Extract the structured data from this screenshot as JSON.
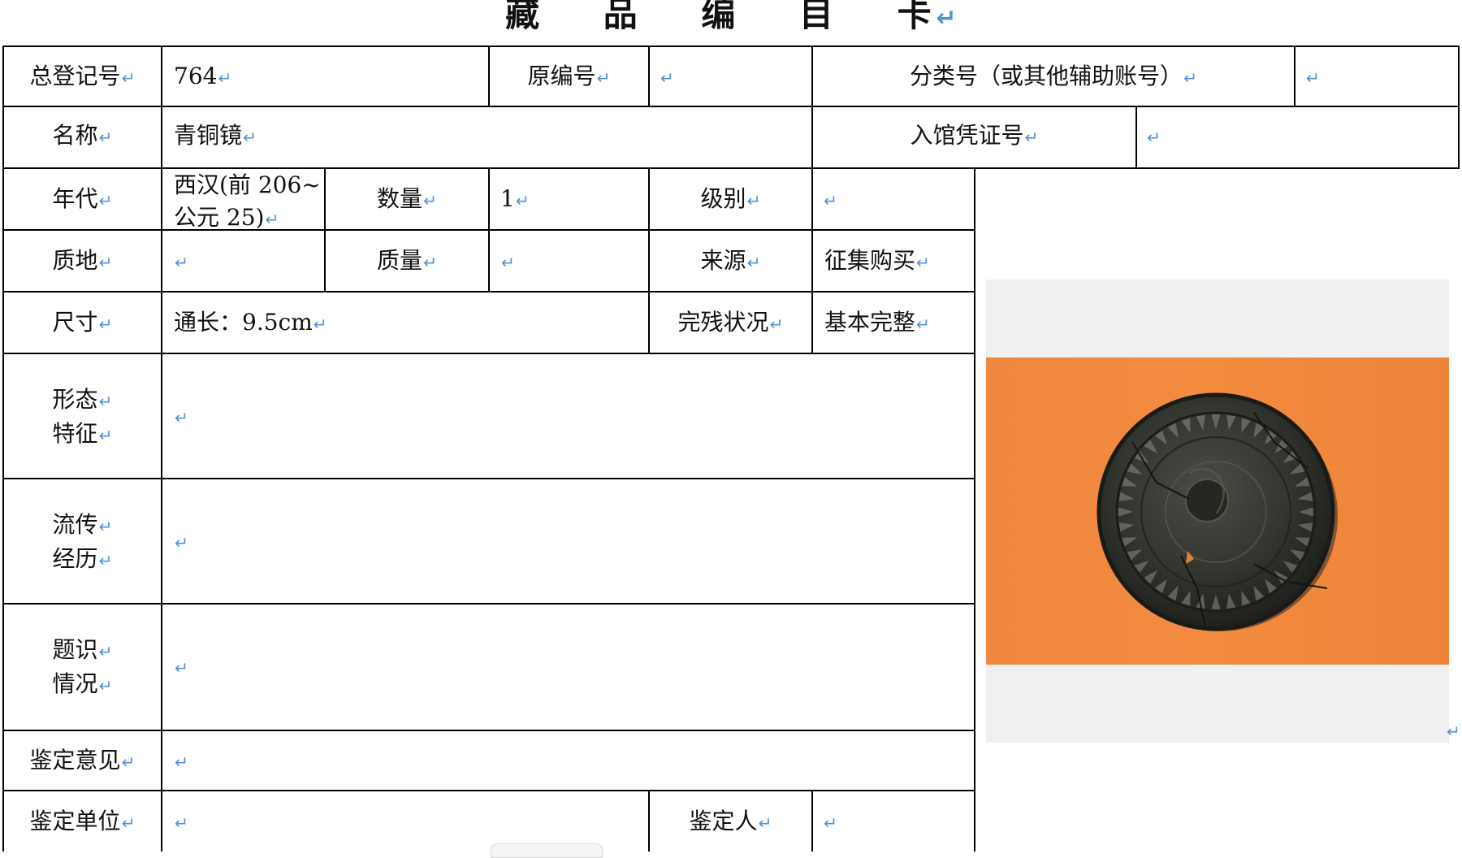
{
  "title": "藏 品 编 目 卡",
  "return_mark": "↵",
  "card": {
    "registration_no_label": "总登记号",
    "registration_no": "764",
    "original_no_label": "原编号",
    "original_no": "",
    "category_no_label": "分类号（或其他辅助账号）",
    "category_no": "",
    "name_label": "名称",
    "name": "青铜镜",
    "entry_voucher_label": "入馆凭证号",
    "entry_voucher": "",
    "era_label": "年代",
    "era_line1": "西汉(前 206~",
    "era_line2": "公元 25)",
    "quantity_label": "数量",
    "quantity": "1",
    "grade_label": "级别",
    "grade": "",
    "material_label": "质地",
    "material": "",
    "weight_label": "质量",
    "weight": "",
    "source_label": "来源",
    "source": "征集购买",
    "size_label": "尺寸",
    "size": "通长：9.5cm",
    "condition_label": "完残状况",
    "condition": "基本完整",
    "form_label_1": "形态",
    "form_label_2": "特征",
    "form": "",
    "history_label_1": "流传",
    "history_label_2": "经历",
    "history": "",
    "inscription_label_1": "题识",
    "inscription_label_2": "情况",
    "inscription": "",
    "appraisal_opinion_label": "鉴定意见",
    "appraisal_opinion": "",
    "appraisal_unit_label": "鉴定单位",
    "appraisal_unit": "",
    "appraiser_label": "鉴定人",
    "appraiser": ""
  },
  "colors": {
    "photo_background": "#f0f0f0",
    "backdrop_orange": "#f08a3f",
    "mirror_dark": "#2f312c",
    "return_mark": "#4f93d6"
  },
  "image": {
    "subject": "bronze-mirror-photo"
  }
}
